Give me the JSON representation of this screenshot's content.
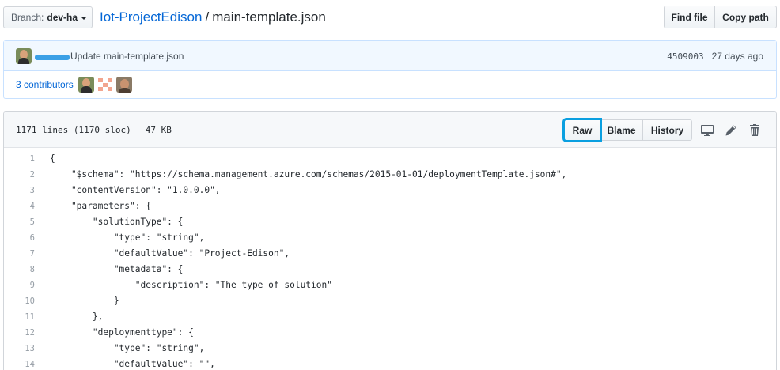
{
  "branch": {
    "prefix": "Branch:",
    "name": "dev-ha"
  },
  "breadcrumb": {
    "repo": "Iot-ProjectEdison",
    "separator": "/",
    "file": "main-template.json"
  },
  "top_actions": {
    "find_file": "Find file",
    "copy_path": "Copy path"
  },
  "commit": {
    "message": "Update main-template.json",
    "sha": "4509003",
    "time": "27 days ago",
    "contributors_label": "3 contributors"
  },
  "file": {
    "lines_info": "1171 lines (1170 sloc)",
    "size": "47 KB",
    "raw": "Raw",
    "blame": "Blame",
    "history": "History"
  },
  "icons": {
    "desktop": "desktop-icon",
    "edit": "pencil-icon",
    "delete": "trash-icon"
  },
  "code": [
    {
      "n": "1",
      "text": "{"
    },
    {
      "n": "2",
      "text": "    \"$schema\": \"https://schema.management.azure.com/schemas/2015-01-01/deploymentTemplate.json#\","
    },
    {
      "n": "3",
      "text": "    \"contentVersion\": \"1.0.0.0\","
    },
    {
      "n": "4",
      "text": "    \"parameters\": {"
    },
    {
      "n": "5",
      "text": "        \"solutionType\": {"
    },
    {
      "n": "6",
      "text": "            \"type\": \"string\","
    },
    {
      "n": "7",
      "text": "            \"defaultValue\": \"Project-Edison\","
    },
    {
      "n": "8",
      "text": "            \"metadata\": {"
    },
    {
      "n": "9",
      "text": "                \"description\": \"The type of solution\""
    },
    {
      "n": "10",
      "text": "            }"
    },
    {
      "n": "11",
      "text": "        },"
    },
    {
      "n": "12",
      "text": "        \"deploymenttype\": {"
    },
    {
      "n": "13",
      "text": "            \"type\": \"string\","
    },
    {
      "n": "14",
      "text": "            \"defaultValue\": \"\","
    }
  ],
  "colors": {
    "link": "#0366d6",
    "highlight": "#0a9fe0",
    "redaction": "#3ba0e6"
  }
}
